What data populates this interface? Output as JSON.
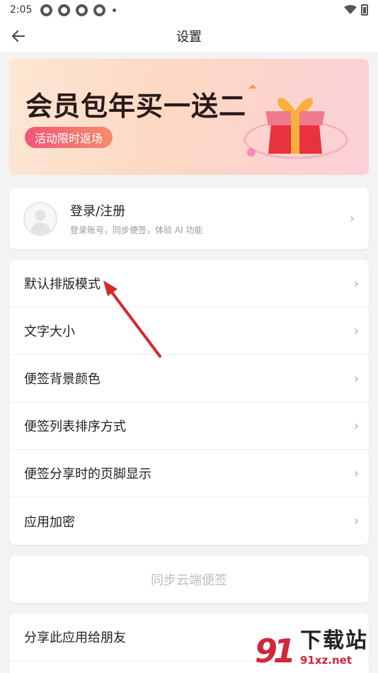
{
  "status": {
    "time": "2:05"
  },
  "header": {
    "title": "设置"
  },
  "banner": {
    "title": "会员包年买一送二",
    "tag": "活动限时返场"
  },
  "login": {
    "title": "登录/注册",
    "subtitle": "登录账号，同步便签，体验 AI 功能"
  },
  "settings": {
    "items": [
      {
        "label": "默认排版模式"
      },
      {
        "label": "文字大小"
      },
      {
        "label": "便签背景颜色"
      },
      {
        "label": "便签列表排序方式"
      },
      {
        "label": "便签分享时的页脚显示"
      },
      {
        "label": "应用加密"
      }
    ]
  },
  "sync": {
    "label": "同步云端便签"
  },
  "share": {
    "label": "分享此应用给朋友"
  },
  "watermark": {
    "logo": "91",
    "title": "下载站",
    "url": "91xz.net"
  },
  "colors": {
    "accent": "#d2263a",
    "arrow": "#d42a2a",
    "tag_start": "#f0567a",
    "tag_end": "#f58c6c"
  },
  "icons": {
    "back": "arrow-left-icon",
    "chevron": "chevron-right-icon"
  }
}
